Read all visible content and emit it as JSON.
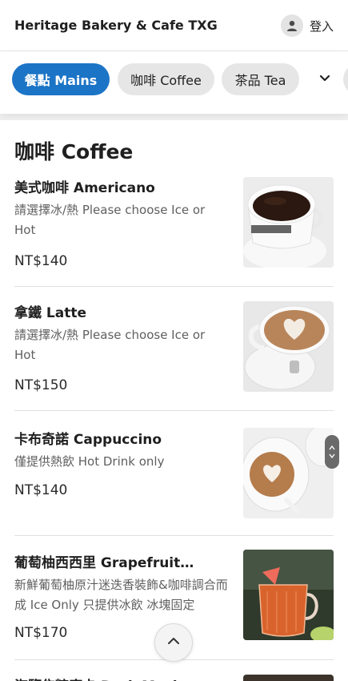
{
  "header": {
    "title": "Heritage Bakery & Cafe TXG",
    "login_label": "登入"
  },
  "tabs": [
    {
      "label": "餐點 Mains",
      "active": true
    },
    {
      "label": "咖啡 Coffee",
      "active": false
    },
    {
      "label": "茶品 Tea",
      "active": false
    }
  ],
  "section": {
    "title": "咖啡 Coffee"
  },
  "items": [
    {
      "name": "美式咖啡 Americano",
      "description": "請選擇冰/熱 Please choose Ice or Hot",
      "price": "NT$140",
      "image": "americano-cup-photo"
    },
    {
      "name": "拿鐵 Latte",
      "description": "請選擇冰/熱 Please choose Ice or Hot",
      "price": "NT$150",
      "image": "latte-art-photo"
    },
    {
      "name": "卡布奇諾 Cappuccino",
      "description": "僅提供熱飲 Hot Drink only",
      "price": "NT$140",
      "image": "cappuccino-photo"
    },
    {
      "name": "葡萄柚西西里 Grapefruit…",
      "description": "新鮮葡萄柚原汁迷迭香裝飾&咖啡調合而成 Ice Only 只提供冰飲 冰塊固定",
      "price": "NT$170",
      "image": "grapefruit-coffee-photo"
    },
    {
      "name": "海鹽焦糖摩卡 Dark Mocha",
      "image": "mocha-photo"
    }
  ],
  "icons": {
    "user": "user-icon",
    "chevron_down": "chevron-down-icon",
    "chevron_up": "chevron-up-icon"
  }
}
